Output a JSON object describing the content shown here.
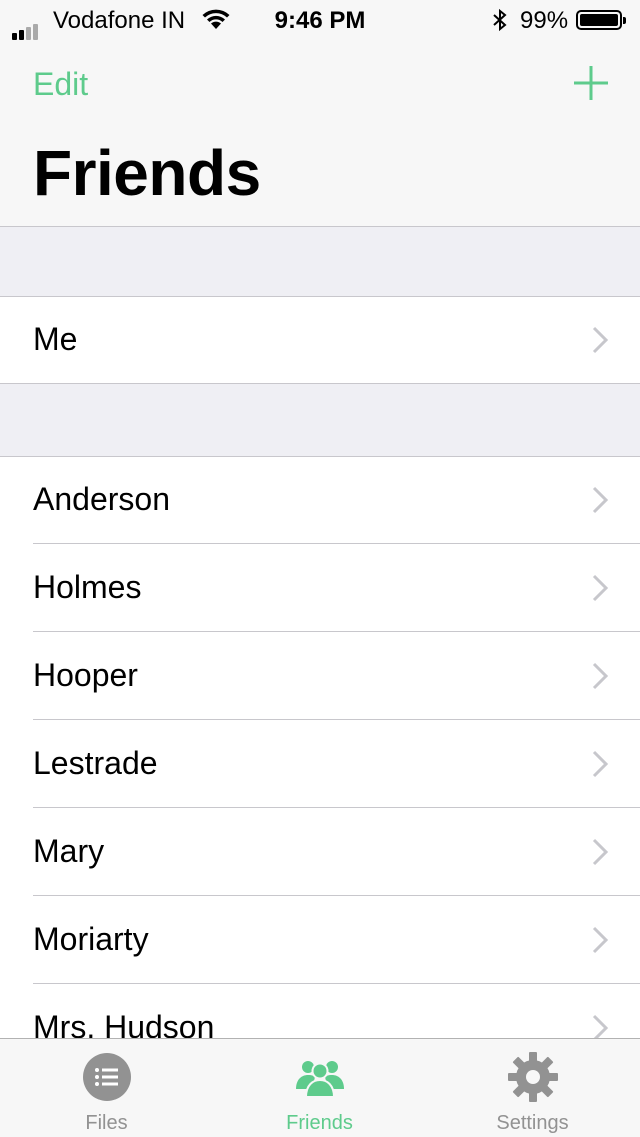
{
  "status_bar": {
    "carrier": "Vodafone IN",
    "time": "9:46 PM",
    "battery_percent": "99%"
  },
  "nav": {
    "edit_label": "Edit",
    "title": "Friends",
    "accent_color": "#5ecb8c"
  },
  "me_section": {
    "label": "Me"
  },
  "friends": [
    {
      "name": "Anderson"
    },
    {
      "name": "Holmes"
    },
    {
      "name": "Hooper"
    },
    {
      "name": "Lestrade"
    },
    {
      "name": "Mary"
    },
    {
      "name": "Moriarty"
    },
    {
      "name": "Mrs. Hudson"
    }
  ],
  "tabs": [
    {
      "label": "Files",
      "icon": "list-icon",
      "active": false
    },
    {
      "label": "Friends",
      "icon": "group-icon",
      "active": true
    },
    {
      "label": "Settings",
      "icon": "gear-icon",
      "active": false
    }
  ]
}
